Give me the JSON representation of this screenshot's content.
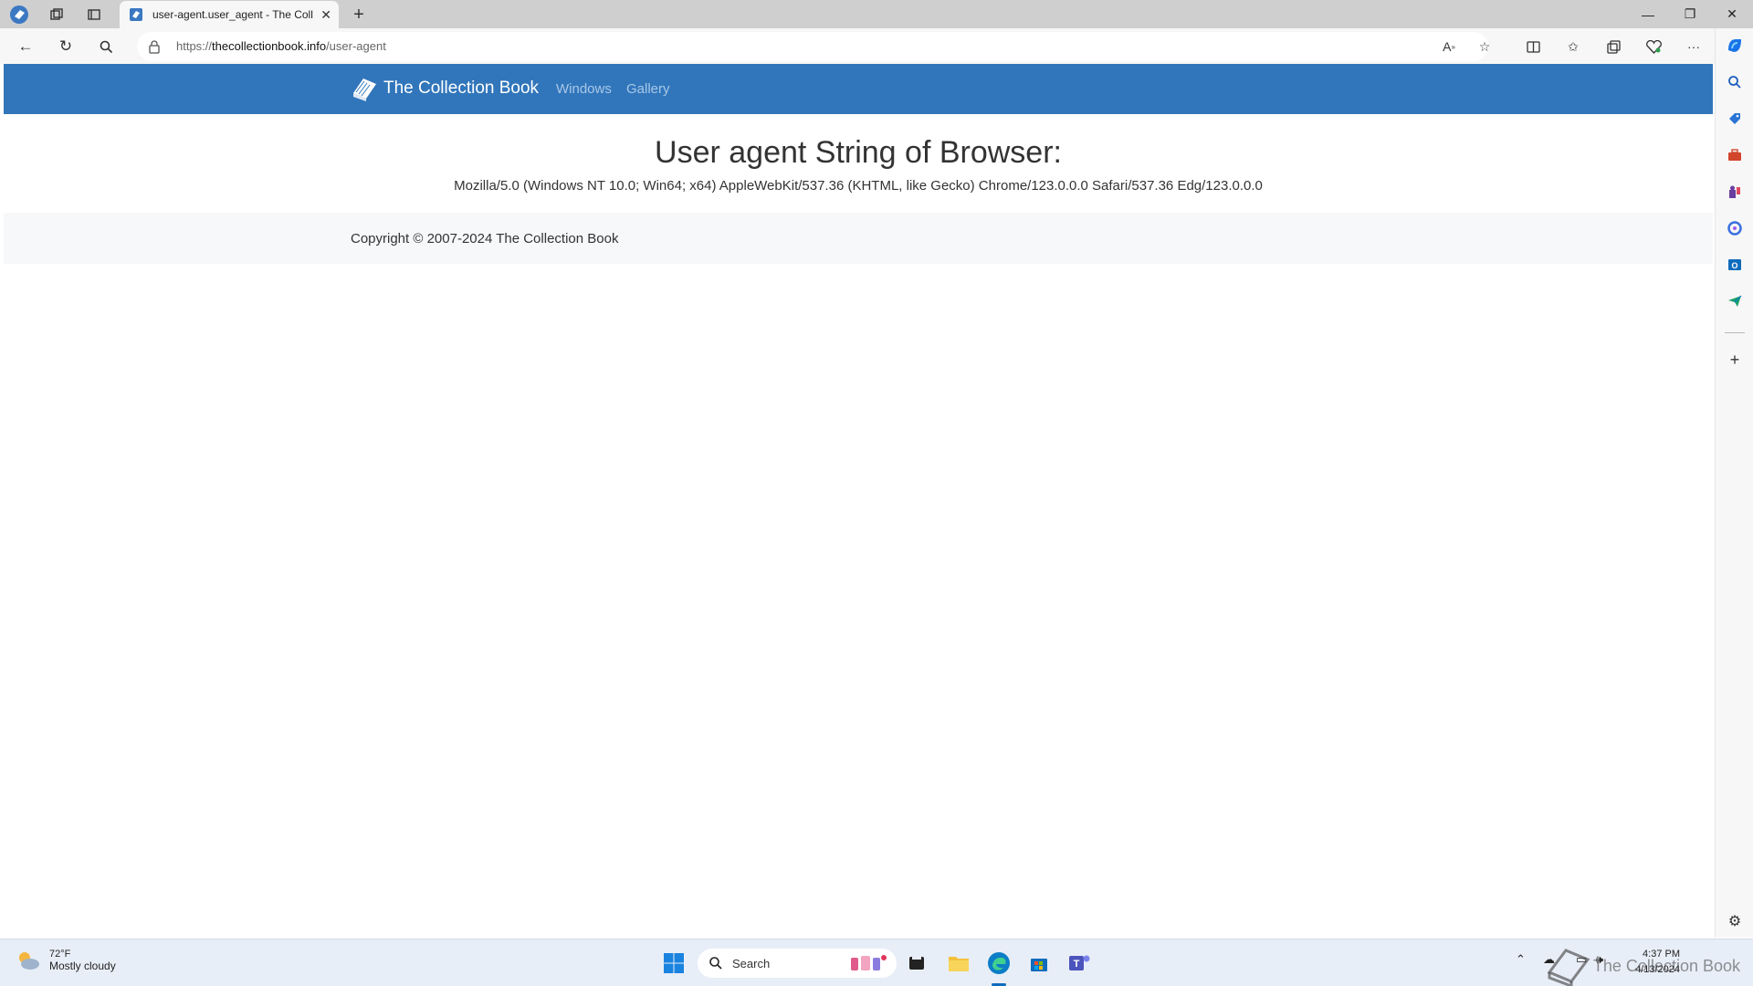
{
  "browser": {
    "tab": {
      "title": "user-agent.user_agent - The Coll"
    },
    "address": {
      "url_prefix": "https://",
      "url_host": "thecollectionbook.info",
      "url_path": "/user-agent"
    }
  },
  "site": {
    "brand": "The Collection Book",
    "nav": [
      "Windows",
      "Gallery"
    ],
    "page_title": "User agent String of Browser:",
    "user_agent": "Mozilla/5.0 (Windows NT 10.0; Win64; x64) AppleWebKit/537.36 (KHTML, like Gecko) Chrome/123.0.0.0 Safari/537.36 Edg/123.0.0.0",
    "copyright": "Copyright © 2007-2024 The Collection Book"
  },
  "taskbar": {
    "weather_temp": "72°F",
    "weather_cond": "Mostly cloudy",
    "search_label": "Search",
    "time": "4:37 PM",
    "date": "4/13/2024",
    "watermark": "The Collection Book"
  },
  "colors": {
    "site_nav": "#3176bb",
    "nav_link": "#a9c8e8",
    "accent": "#0f6cbd"
  }
}
